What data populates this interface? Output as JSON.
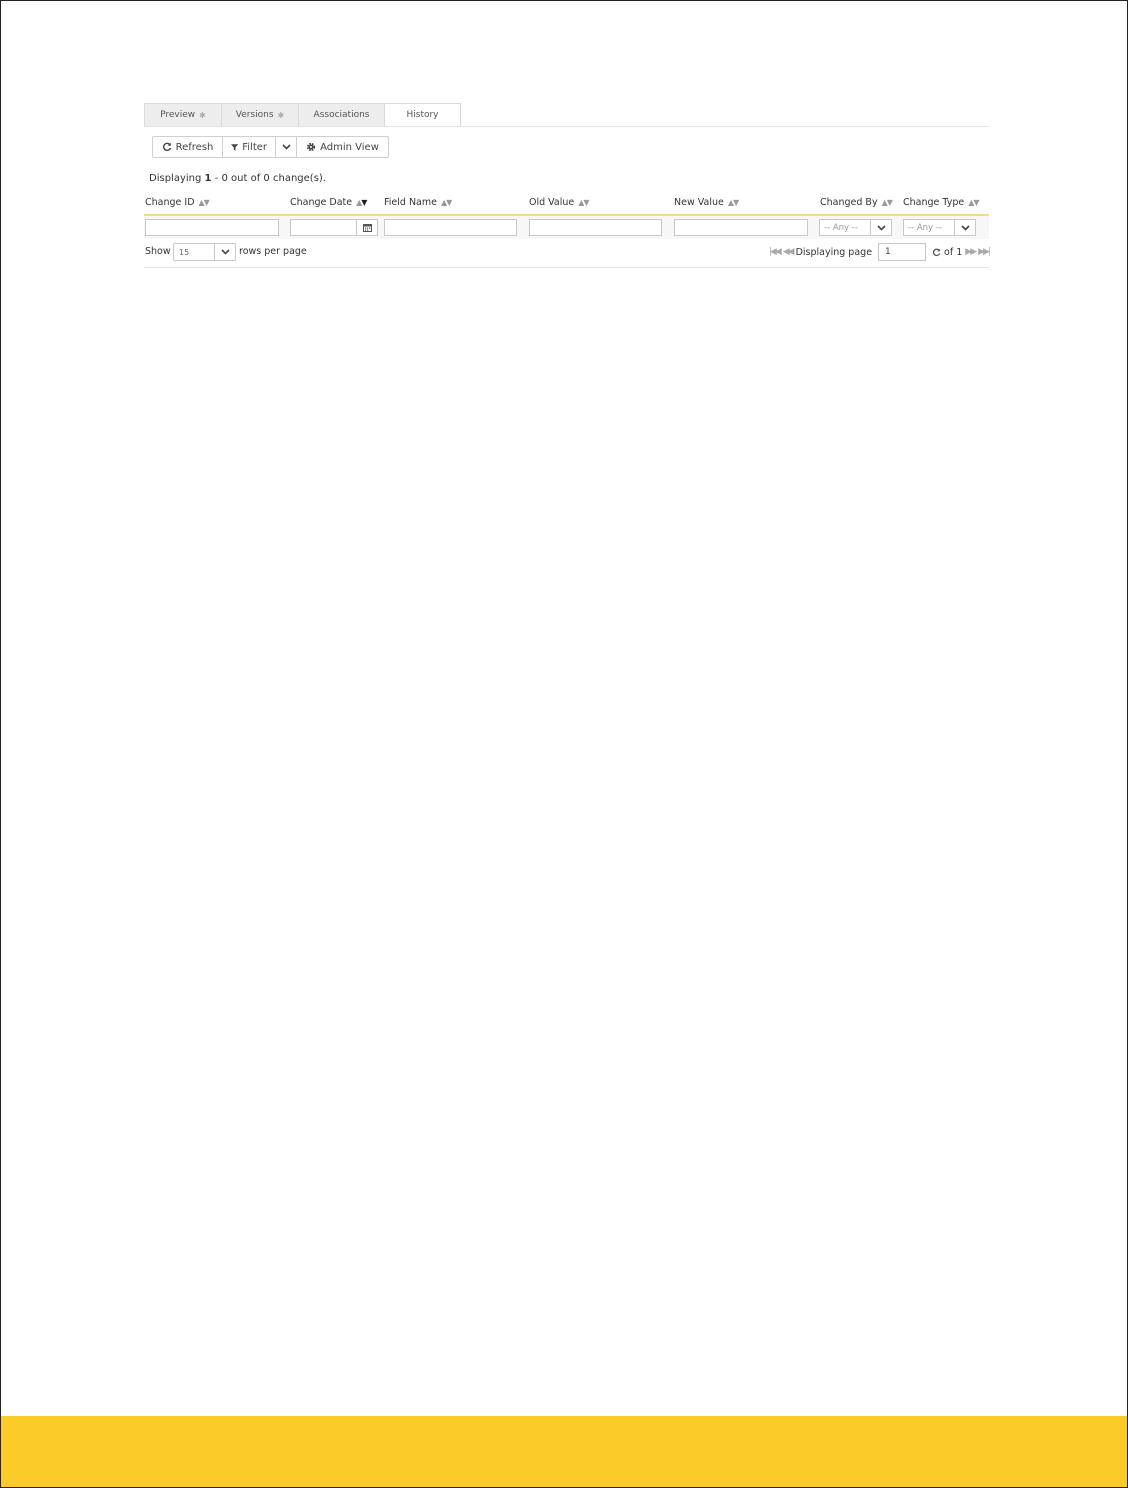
{
  "tabs": [
    {
      "label": "Preview",
      "dot": "✱",
      "active": false
    },
    {
      "label": "Versions",
      "dot": "✱",
      "active": false
    },
    {
      "label": "Associations",
      "dot": "",
      "active": false
    },
    {
      "label": "History",
      "dot": "",
      "active": true
    }
  ],
  "toolbar": {
    "refresh_label": "Refresh",
    "filter_label": "Filter",
    "admin_view_label": "Admin View"
  },
  "summary": {
    "prefix": "Displaying",
    "range_start": "1",
    "dash": "-",
    "range_end": "0",
    "mid": "out of",
    "total": "0",
    "suffix": "change(s)."
  },
  "columns": [
    {
      "label": "Change ID"
    },
    {
      "label": "Change Date"
    },
    {
      "label": "Field Name"
    },
    {
      "label": "Old Value"
    },
    {
      "label": "New Value"
    },
    {
      "label": "Changed By"
    },
    {
      "label": "Change Type"
    }
  ],
  "filters": {
    "changed_by": "-- Any --",
    "change_type": "-- Any --"
  },
  "pager": {
    "show_label": "Show",
    "rows_per_page": "15",
    "rows_label": "rows per page",
    "displaying_page_label": "Displaying page",
    "current_page": "1",
    "of_label": "of 1"
  },
  "colors": {
    "footer_band": "#fbcb27",
    "header_underline": "#f3d98a"
  }
}
